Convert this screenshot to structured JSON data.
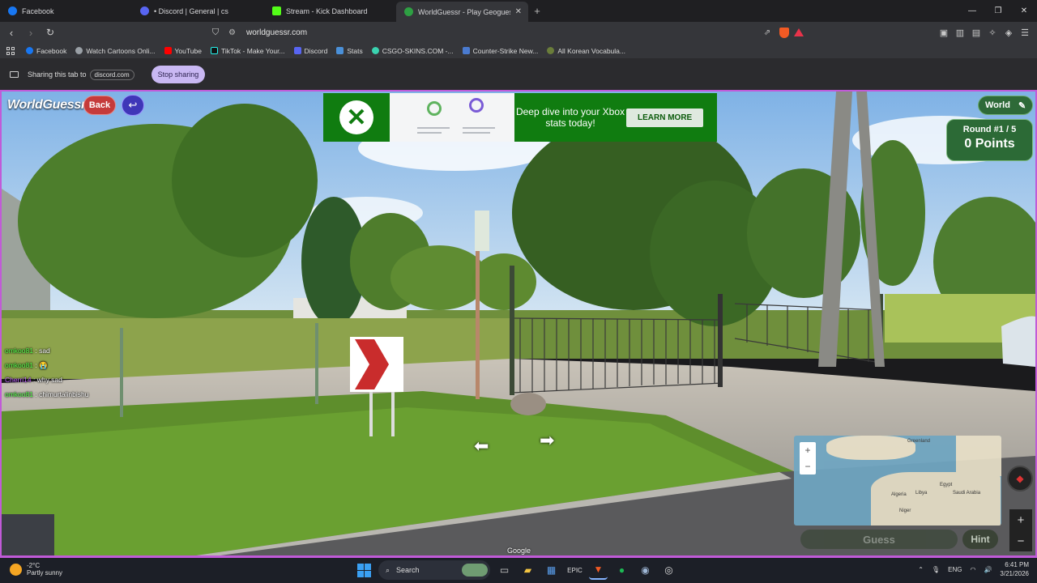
{
  "browser": {
    "tabs": [
      {
        "label": "Facebook",
        "color": "#1877f2",
        "active": false
      },
      {
        "label": "• Discord | General | cs",
        "color": "#5865f2",
        "active": false
      },
      {
        "label": "Stream - Kick Dashboard",
        "color": "#53fc18",
        "active": false
      },
      {
        "label": "WorldGuessr - Play Geoguess",
        "color": "#2ea043",
        "active": true
      }
    ],
    "url": "worldguessr.com",
    "bookmarks": [
      {
        "label": "Facebook",
        "color": "#1877f2"
      },
      {
        "label": "Watch Cartoons Onli...",
        "color": "#9aa0a6"
      },
      {
        "label": "YouTube",
        "color": "#ff0000"
      },
      {
        "label": "TikTok - Make Your...",
        "color": "#111111"
      },
      {
        "label": "Discord",
        "color": "#5865f2"
      },
      {
        "label": "Stats",
        "color": "#4a90d9"
      },
      {
        "label": "CSGO-SKINS.COM -...",
        "color": "#3ad3b0"
      },
      {
        "label": "Counter-Strike New...",
        "color": "#4a7bd0"
      },
      {
        "label": "All Korean Vocabula...",
        "color": "#6a7d3a"
      }
    ],
    "sharing": {
      "text": "Sharing this tab to",
      "target": "discord.com",
      "stop_label": "Stop sharing"
    }
  },
  "game": {
    "logo": "WorldGuessr",
    "back_label": "Back",
    "mode_label": "World",
    "round_label": "Round #1 / 5",
    "points_label": "0 Points",
    "guess_label": "Guess",
    "hint_label": "Hint",
    "google_label": "Google",
    "ad": {
      "headline": "Deep dive into your Xbox stats today!",
      "cta": "LEARN MORE"
    },
    "map_labels": [
      "Greenland",
      "Libya",
      "Algeria",
      "Niger",
      "Saudi Arabia",
      "Egypt"
    ]
  },
  "chat": [
    {
      "user": "omkoo81",
      "sep": " : ",
      "msg": "sad",
      "color": "#57ff4c"
    },
    {
      "user": "omkoo81",
      "sep": " : ",
      "msg": "😭",
      "color": "#57ff4c"
    },
    {
      "user": "Cherri14",
      "sep": " : ",
      "msg": "why sad",
      "color": "#c56bff"
    },
    {
      "user": "omkoo81",
      "sep": " : ",
      "msg": "chimurtalinbishu",
      "color": "#57ff4c"
    }
  ],
  "taskbar": {
    "temp": "-2°C",
    "weather": "Partly sunny",
    "search_label": "Search",
    "lang": "ENG",
    "time": "6:41 PM",
    "date": "3/21/2026"
  }
}
